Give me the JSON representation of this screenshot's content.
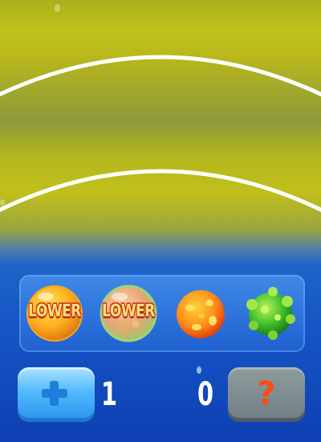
{
  "colors": {
    "background_top": "#b8bb1c",
    "background_bottom": "#0e3fb3",
    "lower_text": "#ffe07a",
    "hint_mark": "#ff4a14",
    "add_button": "#51b9ff",
    "hint_button": "#7f8d91"
  },
  "tray": {
    "items": [
      {
        "label": "LOWER",
        "kind": "orange-bubble"
      },
      {
        "label": "LOWER",
        "kind": "pink-bubble"
      },
      {
        "label": "",
        "kind": "orange-spotted-ball"
      },
      {
        "label": "",
        "kind": "green-spiky-ball"
      }
    ]
  },
  "controls": {
    "add_icon": "plus-icon",
    "left_count": "1",
    "right_count": "0",
    "hint_label": "?"
  }
}
